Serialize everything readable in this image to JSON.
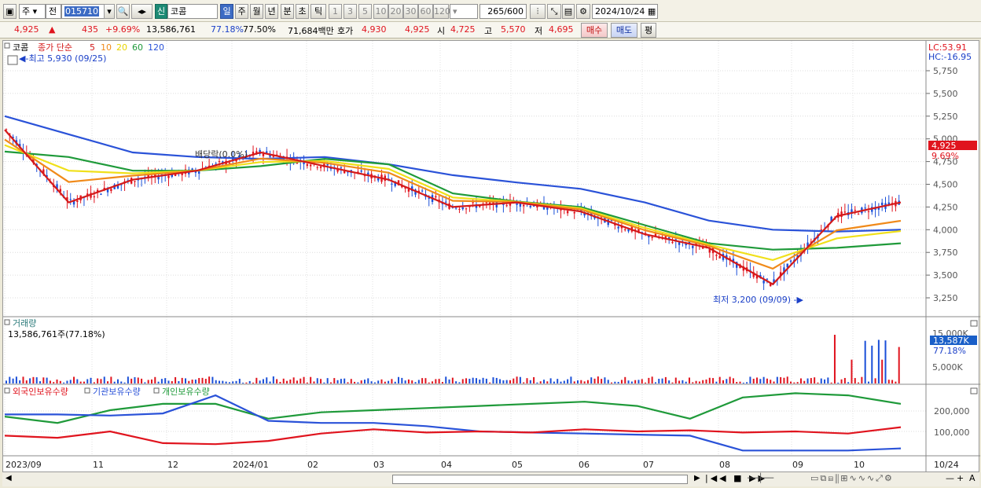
{
  "toolbar": {
    "type_label": "주",
    "range_label": "전",
    "code_value": "015710",
    "new_label": "신",
    "stock_name": "코콤",
    "periods": [
      "일",
      "주",
      "월",
      "년",
      "분",
      "초",
      "틱"
    ],
    "active_period": "일",
    "minute_options": [
      "1",
      "3",
      "5",
      "10",
      "20",
      "30",
      "60",
      "120"
    ],
    "count_value": "265",
    "count_total": "/600",
    "date_value": "2024/10/24"
  },
  "quote": {
    "price": "4,925",
    "change_arrow": "▲",
    "change": "435",
    "change_pct": "+9.69%",
    "volume": "13,586,761",
    "vol_pct": "77.18%",
    "turnover_pct": "77.50%",
    "amount": "71,684백만",
    "ask_label": "호가",
    "ask": "4,930",
    "bid": "4,925",
    "open_label": "시",
    "open": "4,725",
    "high_label": "고",
    "high": "5,570",
    "low_label": "저",
    "low": "4,695",
    "buy_label": "매수",
    "sell_label": "매도",
    "eval_label": "평"
  },
  "price_panel": {
    "legend_name": "코콤",
    "legend_ma": "종가 단순",
    "ma_periods": [
      "5",
      "10",
      "20",
      "60",
      "120"
    ],
    "ma_colors": [
      "#d41a1a",
      "#f08a1a",
      "#f0e01a",
      "#1f9a3a",
      "#2a52d8"
    ],
    "max_label": "최고 5,930 (09/25)",
    "min_label": "최저 3,200 (09/09)",
    "ex_dividend_label": "배당락(0.0%)",
    "lc_label": "LC:53.91",
    "hc_label": "HC:-16.95",
    "y_ticks": [
      "5,750",
      "5,500",
      "5,250",
      "5,000",
      "4,750",
      "4,500",
      "4,250",
      "4,000",
      "3,750",
      "3,500",
      "3,250"
    ],
    "y_values": [
      5750,
      5500,
      5250,
      5000,
      4750,
      4500,
      4250,
      4000,
      3750,
      3500,
      3250
    ],
    "current_label": "4,925",
    "current_pct": "9.69%"
  },
  "volume_panel": {
    "title": "거래량",
    "info": "13,586,761주(77.18%)",
    "y_ticks": [
      "15,000K",
      "5,000K"
    ],
    "current_label": "13,587K",
    "current_pct": "77.18%"
  },
  "holdings_panel": {
    "legend": [
      {
        "label": "외국인보유수량",
        "color": "#e0141e"
      },
      {
        "label": "기관보유수량",
        "color": "#2a52d8"
      },
      {
        "label": "개인보유수량",
        "color": "#1f9a3a"
      }
    ],
    "y_ticks": [
      "200,000",
      "100,000"
    ]
  },
  "x_axis": {
    "labels": [
      "2023/09",
      "11",
      "12",
      "2024/01",
      "02",
      "03",
      "04",
      "05",
      "06",
      "07",
      "08",
      "09",
      "10",
      "10/24"
    ]
  },
  "chart_data": {
    "type": "line",
    "title": "",
    "x": [
      "2023/09",
      "11",
      "12",
      "2024/01",
      "02",
      "03",
      "04",
      "05",
      "06",
      "07",
      "08",
      "09",
      "10"
    ],
    "ylim": [
      3150,
      5850
    ],
    "series": [
      {
        "name": "5",
        "values": [
          5100,
          4300,
          4550,
          4650,
          4850,
          4700,
          4550,
          4250,
          4300,
          4200,
          3950,
          3800,
          3400,
          4150,
          4300
        ]
      },
      {
        "name": "60",
        "values": [
          4860,
          4800,
          4650,
          4650,
          4700,
          4780,
          4720,
          4400,
          4310,
          4250,
          4050,
          3850,
          3780,
          3800,
          3850
        ]
      },
      {
        "name": "120",
        "values": [
          5250,
          5050,
          4850,
          4800,
          4780,
          4800,
          4720,
          4600,
          4520,
          4450,
          4300,
          4100,
          4000,
          3980,
          4000
        ]
      }
    ]
  }
}
